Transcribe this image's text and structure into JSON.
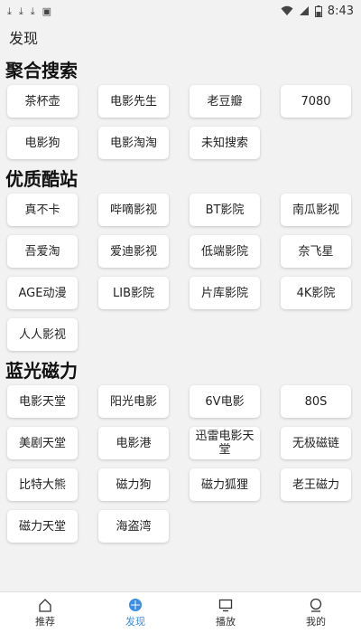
{
  "status_bar": {
    "time": "8:43",
    "left_icons": [
      "download-icon",
      "download-icon",
      "download-icon",
      "image-icon"
    ],
    "right_icons": [
      "wifi-icon",
      "signal-icon",
      "battery-icon"
    ]
  },
  "header": {
    "title": "发现"
  },
  "sections": [
    {
      "title": "聚合搜索",
      "items": [
        "茶杯壶",
        "电影先生",
        "老豆瓣",
        "7080",
        "电影狗",
        "电影淘淘",
        "未知搜索"
      ]
    },
    {
      "title": "优质酷站",
      "items": [
        "真不卡",
        "哔嘀影视",
        "BT影院",
        "南瓜影视",
        "吾爱淘",
        "爱迪影视",
        "低端影院",
        "奈飞星",
        "AGE动漫",
        "LIB影院",
        "片库影院",
        "4K影院",
        "人人影视"
      ]
    },
    {
      "title": "蓝光磁力",
      "items": [
        "电影天堂",
        "阳光电影",
        "6V电影",
        "80S",
        "美剧天堂",
        "电影港",
        "迅雷电影天堂",
        "无极磁链",
        "比特大熊",
        "磁力狗",
        "磁力狐狸",
        "老王磁力",
        "磁力天堂",
        "海盗湾"
      ]
    }
  ],
  "bottom_nav": [
    {
      "label": "推荐",
      "icon": "home-icon",
      "active": false
    },
    {
      "label": "发现",
      "icon": "discover-icon",
      "active": true
    },
    {
      "label": "播放",
      "icon": "tv-icon",
      "active": false
    },
    {
      "label": "我的",
      "icon": "user-icon",
      "active": false
    }
  ],
  "colors": {
    "accent": "#3a8ee6",
    "background": "#f2f2f2",
    "chip": "#ffffff"
  }
}
